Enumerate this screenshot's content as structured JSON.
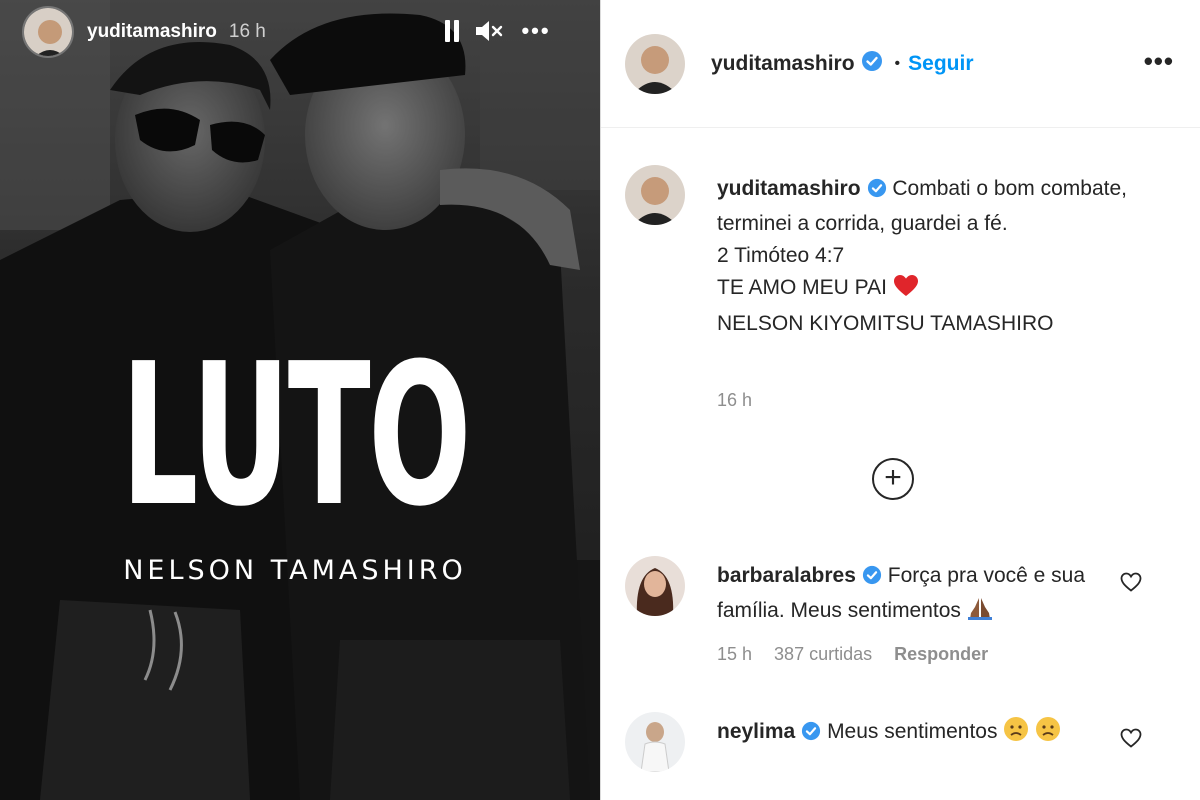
{
  "story": {
    "username": "yuditamashiro",
    "time": "16 h",
    "title": "LUTO",
    "subtitle": "NELSON TAMASHIRO",
    "icons": [
      "pause-icon",
      "mute-icon",
      "more-icon"
    ]
  },
  "post": {
    "header": {
      "username": "yuditamashiro",
      "separator": "•",
      "follow_label": "Seguir"
    },
    "caption": {
      "username": "yuditamashiro",
      "text_line1": "Combati o bom combate, terminei a corrida, guardei a fé.",
      "text_line2": "2 Timóteo 4:7",
      "text_line3": "TE AMO MEU PAI",
      "text_line4": "NELSON KIYOMITSU TAMASHIRO",
      "time": "16 h"
    },
    "load_more_symbol": "+",
    "comments": [
      {
        "username": "barbaralabres",
        "text": "Força pra você e sua família. Meus sentimentos",
        "time": "15 h",
        "likes": "387 curtidas",
        "reply_label": "Responder"
      },
      {
        "username": "neylima",
        "text": "Meus sentimentos"
      }
    ],
    "colors": {
      "accent": "#0095f6",
      "verified": "#3897f0",
      "heart": "#ed4956",
      "muted_text": "#8e8e8e"
    }
  }
}
